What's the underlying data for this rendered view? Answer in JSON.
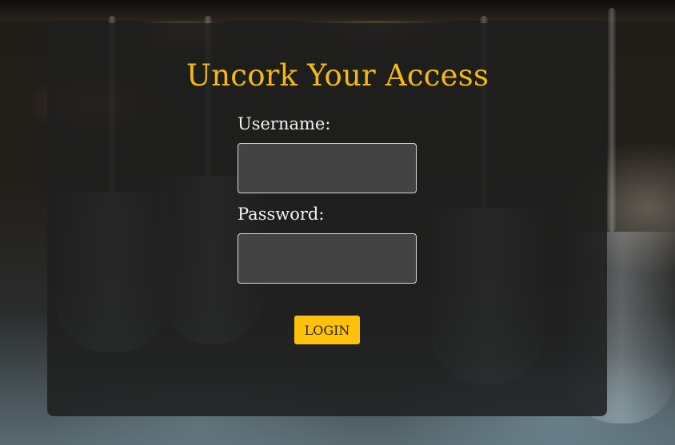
{
  "form": {
    "title": "Uncork Your Access",
    "username_label": "Username:",
    "username_value": "",
    "password_label": "Password:",
    "password_value": "",
    "login_label": "LOGIN"
  },
  "colors": {
    "accent": "#f5b90f",
    "button_bg": "#ffc10a",
    "panel_bg": "#1e1e1e",
    "field_bg": "#434343"
  }
}
